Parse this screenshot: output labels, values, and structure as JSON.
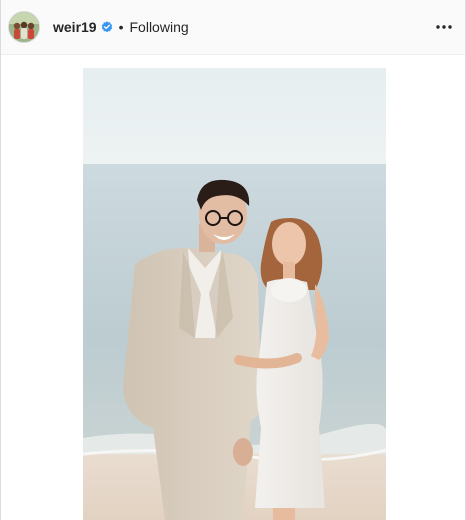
{
  "post": {
    "username": "weir19",
    "separator": "•",
    "follow_status": "Following",
    "verified_icon": "verified-badge-icon",
    "more_icon": "more-options-icon",
    "avatar_icon": "avatar-image",
    "photo_icon": "post-photo"
  },
  "colors": {
    "verified": "#3897f0",
    "text": "#262626",
    "border": "#dbdbdb"
  }
}
